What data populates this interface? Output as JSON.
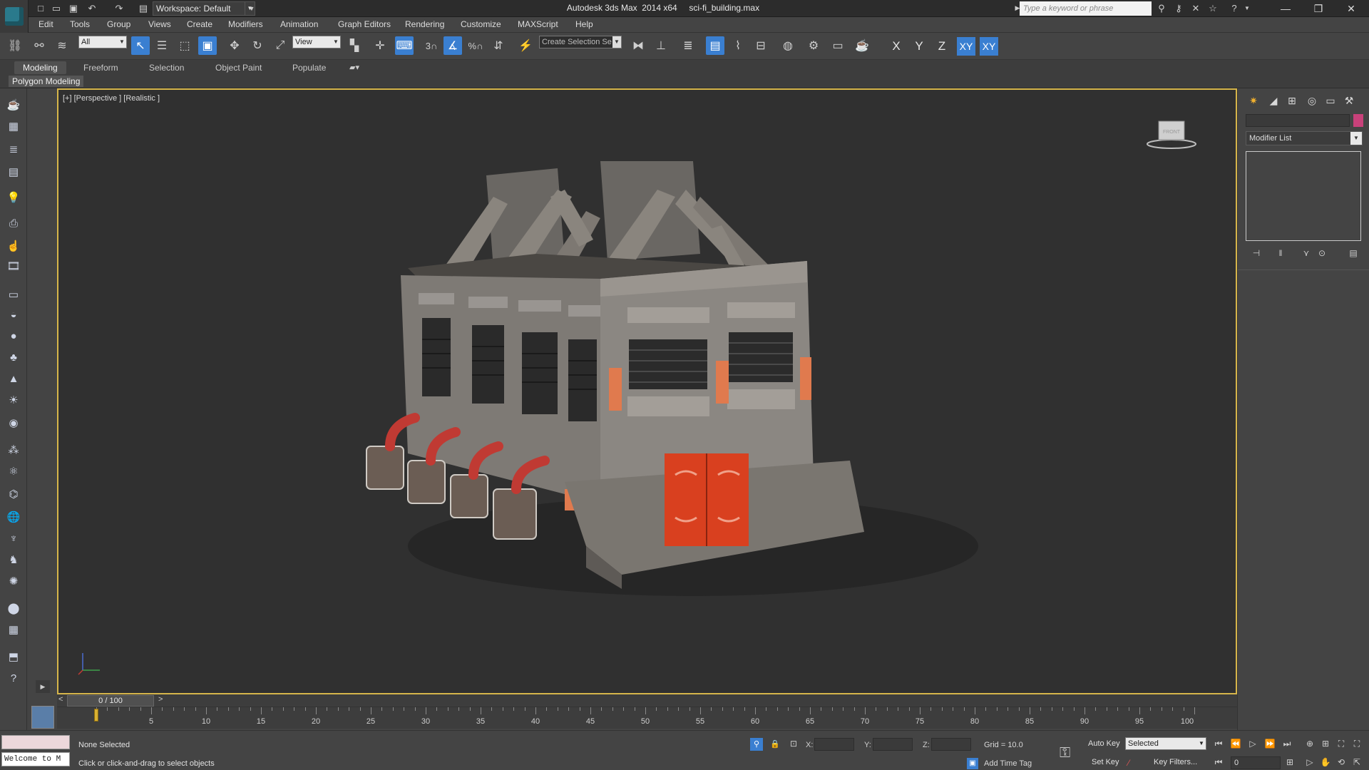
{
  "titlebar": {
    "workspace_label": "Workspace: Default",
    "title": "Autodesk 3ds Max  2014 x64     sci-fi_building.max",
    "search_placeholder": "Type a keyword or phrase"
  },
  "menu": [
    "Edit",
    "Tools",
    "Group",
    "Views",
    "Create",
    "Modifiers",
    "Animation",
    "Graph Editors",
    "Rendering",
    "Customize",
    "MAXScript",
    "Help"
  ],
  "toolbar": {
    "selection_filter": "All",
    "ref_coord": "View",
    "named_selection": "Create Selection Se",
    "snap_label": "3",
    "axis_x": "X",
    "axis_y": "Y",
    "axis_z": "Z",
    "axis_xy": "XY",
    "axis_xy2": "XY"
  },
  "ribbon": {
    "tabs": [
      "Modeling",
      "Freeform",
      "Selection",
      "Object Paint",
      "Populate"
    ],
    "active_tab": "Modeling",
    "panel_label": "Polygon Modeling"
  },
  "viewport": {
    "label": "[+] [Perspective ] [Realistic ]",
    "viewcube_label": "FRONT"
  },
  "command_panel": {
    "modifier_list": "Modifier List",
    "object_color": "#c8417a"
  },
  "timeline": {
    "slider_label": "0 / 100",
    "ticks": [
      "5",
      "10",
      "15",
      "20",
      "25",
      "30",
      "35",
      "40",
      "45",
      "50",
      "55",
      "60",
      "65",
      "70",
      "75",
      "80",
      "85",
      "90",
      "95",
      "100"
    ]
  },
  "status": {
    "maxscript_text": "Welcome to M",
    "selection": "None Selected",
    "prompt": "Click or click-and-drag to select objects",
    "x_label": "X:",
    "y_label": "Y:",
    "z_label": "Z:",
    "grid": "Grid = 10.0",
    "add_time_tag": "Add Time Tag",
    "auto_key": "Auto Key",
    "set_key": "Set Key",
    "key_mode": "Selected",
    "key_filters": "Key Filters...",
    "current_frame": "0"
  },
  "colors": {
    "accent": "#3a7fd1",
    "viewport_border": "#d6b54a",
    "door": "#d9401f"
  }
}
